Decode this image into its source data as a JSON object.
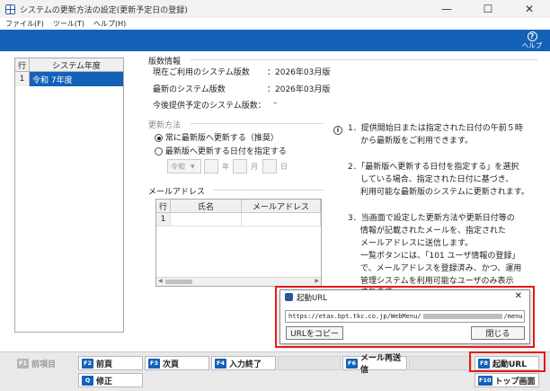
{
  "window": {
    "title": "システムの更新方法の設定(更新予定日の登録)",
    "controls": [
      "—",
      "☐",
      "✕"
    ]
  },
  "menu": [
    "ファイル(F)",
    "ツール(T)",
    "ヘルプ(H)"
  ],
  "header": {
    "help_label": "ヘルプ",
    "help_icon": "question-circle-icon",
    "band_color": "#1461b8"
  },
  "system_table": {
    "columns": [
      "行",
      "システム年度"
    ],
    "rows": [
      {
        "row": "1",
        "year": "令和 7年度"
      }
    ]
  },
  "version_info": {
    "heading": "版数情報",
    "current_label": "現在ご利用のシステム版数",
    "current_value": "：2026年03月版",
    "latest_label": "最新のシステム版数",
    "latest_value": "：2026年03月版",
    "planned_label": "今後提供予定のシステム版数：",
    "planned_value": "–"
  },
  "update_method": {
    "heading": "更新方法",
    "options": [
      {
        "label": "常に最新版へ更新する（推奨）",
        "selected": true
      },
      {
        "label": "最新版へ更新する日付を指定する",
        "selected": false
      }
    ],
    "date": {
      "era": "令和",
      "year_unit": "年",
      "month_unit": "月",
      "day_unit": "日"
    }
  },
  "mail_address": {
    "heading": "メールアドレス",
    "columns": [
      "行",
      "氏名",
      "メールアドレス"
    ],
    "rows": [
      {
        "row": "1",
        "name": "",
        "email": ""
      }
    ]
  },
  "notes": {
    "info_icon": "info-circle-icon",
    "lines": [
      "1．提供開始日または指定された日付の午前５時",
      "から最新版をご利用できます。",
      "2．「最新版へ更新する日付を指定する」を選択",
      "している場合、指定された日付に基づき、",
      "利用可能な最新版のシステムに更新されます。",
      "3．当画面で設定した更新方法や更新日付等の",
      "情報が記載されたメールを、指定された",
      "メールアドレスに送信します。",
      "一覧ボタンには、「101 ユーザ情報の登録」",
      "で、メールアドレスを登録済み、かつ、運用",
      "管理システムを利用可能なユーザのみ表示",
      "されます。"
    ]
  },
  "popup": {
    "title": "起動URL",
    "url": "https://etax.bpt.tkc.co.jp/WebMenu/",
    "url_suffix": "/menu",
    "copy_button": "URLをコピー",
    "close_button": "閉じる"
  },
  "function_keys": [
    {
      "key": "F1",
      "label": "前項目",
      "enabled": false
    },
    {
      "key": "F2",
      "label": "前頁",
      "enabled": true
    },
    {
      "key": "F3",
      "label": "次頁",
      "enabled": true
    },
    {
      "key": "F4",
      "label": "入力終了",
      "enabled": true
    },
    {
      "key": "F5",
      "label": "",
      "enabled": false
    },
    {
      "key": "F6",
      "label": "メール再送信",
      "enabled": true
    },
    {
      "key": "F7",
      "label": "",
      "enabled": false
    },
    {
      "key": "F8",
      "label": "起動URL",
      "enabled": true
    },
    {
      "key": "Q",
      "label": "修正",
      "enabled": true
    },
    {
      "key": "F10",
      "label": "トップ画面",
      "enabled": true
    }
  ],
  "highlight_color": "#e51a1a"
}
